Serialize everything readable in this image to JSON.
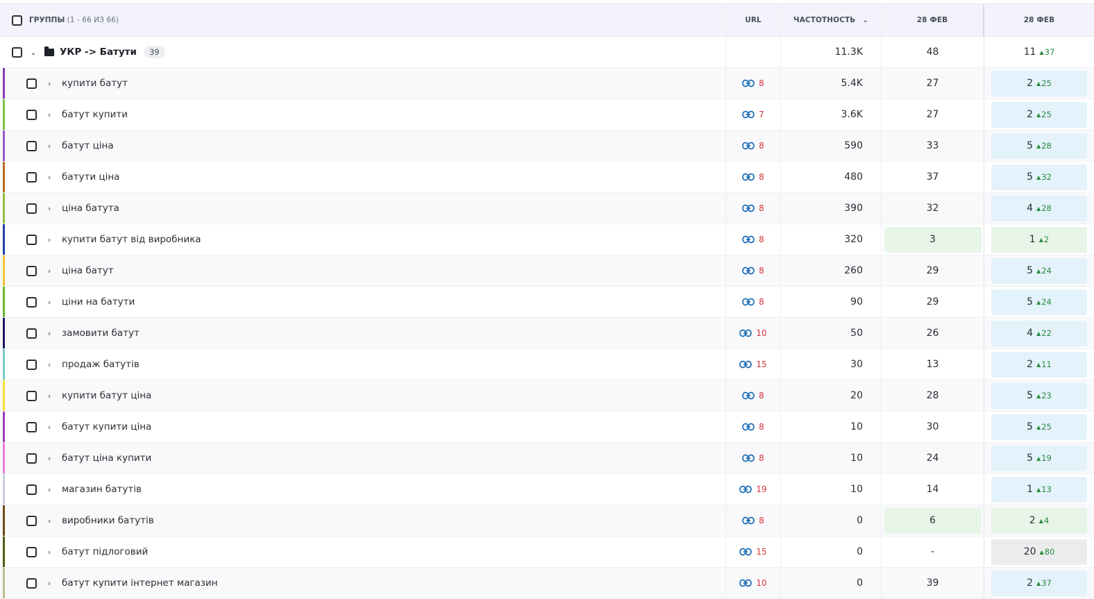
{
  "header": {
    "groups_label": "ГРУППЫ",
    "groups_count": "(1 - 66 ИЗ 66)",
    "url": "URL",
    "frequency": "ЧАСТОТНОСТЬ",
    "date1": "28 ФЕВ",
    "date2": "28 ФЕВ"
  },
  "group": {
    "title": "УКР -> Батути",
    "count": "39",
    "frequency": "11.3K",
    "date1": "48",
    "pos": "11",
    "delta": "37"
  },
  "colors": {
    "up_arrow": "#2a8a3e",
    "url_count": "#d4323b",
    "link_icon": "#1f6fb8"
  },
  "rows": [
    {
      "keyword": "купити батут",
      "url_count": "8",
      "frequency": "5.4K",
      "date1": "27",
      "pos": "2",
      "delta": "25",
      "stripe": "#8a3ab9",
      "d1_style": "",
      "d2_style": "blue"
    },
    {
      "keyword": "батут купити",
      "url_count": "7",
      "frequency": "3.6K",
      "date1": "27",
      "pos": "2",
      "delta": "25",
      "stripe": "#7cc243",
      "d1_style": "",
      "d2_style": "blue"
    },
    {
      "keyword": "батут ціна",
      "url_count": "8",
      "frequency": "590",
      "date1": "33",
      "pos": "5",
      "delta": "28",
      "stripe": "#9b59d0",
      "d1_style": "",
      "d2_style": "blue"
    },
    {
      "keyword": "батути ціна",
      "url_count": "8",
      "frequency": "480",
      "date1": "37",
      "pos": "5",
      "delta": "32",
      "stripe": "#b86a1e",
      "d1_style": "",
      "d2_style": "blue"
    },
    {
      "keyword": "ціна батута",
      "url_count": "8",
      "frequency": "390",
      "date1": "32",
      "pos": "4",
      "delta": "28",
      "stripe": "#8fbf3c",
      "d1_style": "",
      "d2_style": "blue"
    },
    {
      "keyword": "купити батут від виробника",
      "url_count": "8",
      "frequency": "320",
      "date1": "3",
      "pos": "1",
      "delta": "2",
      "stripe": "#1f3fa8",
      "d1_style": "green",
      "d2_style": "green"
    },
    {
      "keyword": "ціна батут",
      "url_count": "8",
      "frequency": "260",
      "date1": "29",
      "pos": "5",
      "delta": "24",
      "stripe": "#f2c233",
      "d1_style": "",
      "d2_style": "blue"
    },
    {
      "keyword": "ціни на батути",
      "url_count": "8",
      "frequency": "90",
      "date1": "29",
      "pos": "5",
      "delta": "24",
      "stripe": "#6ab82f",
      "d1_style": "",
      "d2_style": "blue"
    },
    {
      "keyword": "замовити батут",
      "url_count": "10",
      "frequency": "50",
      "date1": "26",
      "pos": "4",
      "delta": "22",
      "stripe": "#1c1466",
      "d1_style": "",
      "d2_style": "blue"
    },
    {
      "keyword": "продаж батутів",
      "url_count": "15",
      "frequency": "30",
      "date1": "13",
      "pos": "2",
      "delta": "11",
      "stripe": "#79c9c1",
      "d1_style": "",
      "d2_style": "blue"
    },
    {
      "keyword": "купити батут ціна",
      "url_count": "8",
      "frequency": "20",
      "date1": "28",
      "pos": "5",
      "delta": "23",
      "stripe": "#f5df2e",
      "d1_style": "",
      "d2_style": "blue"
    },
    {
      "keyword": "батут купити ціна",
      "url_count": "8",
      "frequency": "10",
      "date1": "30",
      "pos": "5",
      "delta": "25",
      "stripe": "#9d3fbf",
      "d1_style": "",
      "d2_style": "blue"
    },
    {
      "keyword": "батут ціна купити",
      "url_count": "8",
      "frequency": "10",
      "date1": "24",
      "pos": "5",
      "delta": "19",
      "stripe": "#e77ad9",
      "d1_style": "",
      "d2_style": "blue"
    },
    {
      "keyword": "магазин батутів",
      "url_count": "19",
      "frequency": "10",
      "date1": "14",
      "pos": "1",
      "delta": "13",
      "stripe": "#c7cfd8",
      "d1_style": "",
      "d2_style": "blue"
    },
    {
      "keyword": "виробники батутів",
      "url_count": "8",
      "frequency": "0",
      "date1": "6",
      "pos": "2",
      "delta": "4",
      "stripe": "#6b4a12",
      "d1_style": "green",
      "d2_style": "green"
    },
    {
      "keyword": "батут підлоговий",
      "url_count": "15",
      "frequency": "0",
      "date1": "-",
      "pos": "20",
      "delta": "80",
      "stripe": "#4a5e12",
      "d1_style": "",
      "d2_style": "gray"
    },
    {
      "keyword": "батут купити інтернет магазин",
      "url_count": "10",
      "frequency": "0",
      "date1": "39",
      "pos": "2",
      "delta": "37",
      "stripe": "#b9bf8a",
      "d1_style": "",
      "d2_style": "blue"
    }
  ]
}
